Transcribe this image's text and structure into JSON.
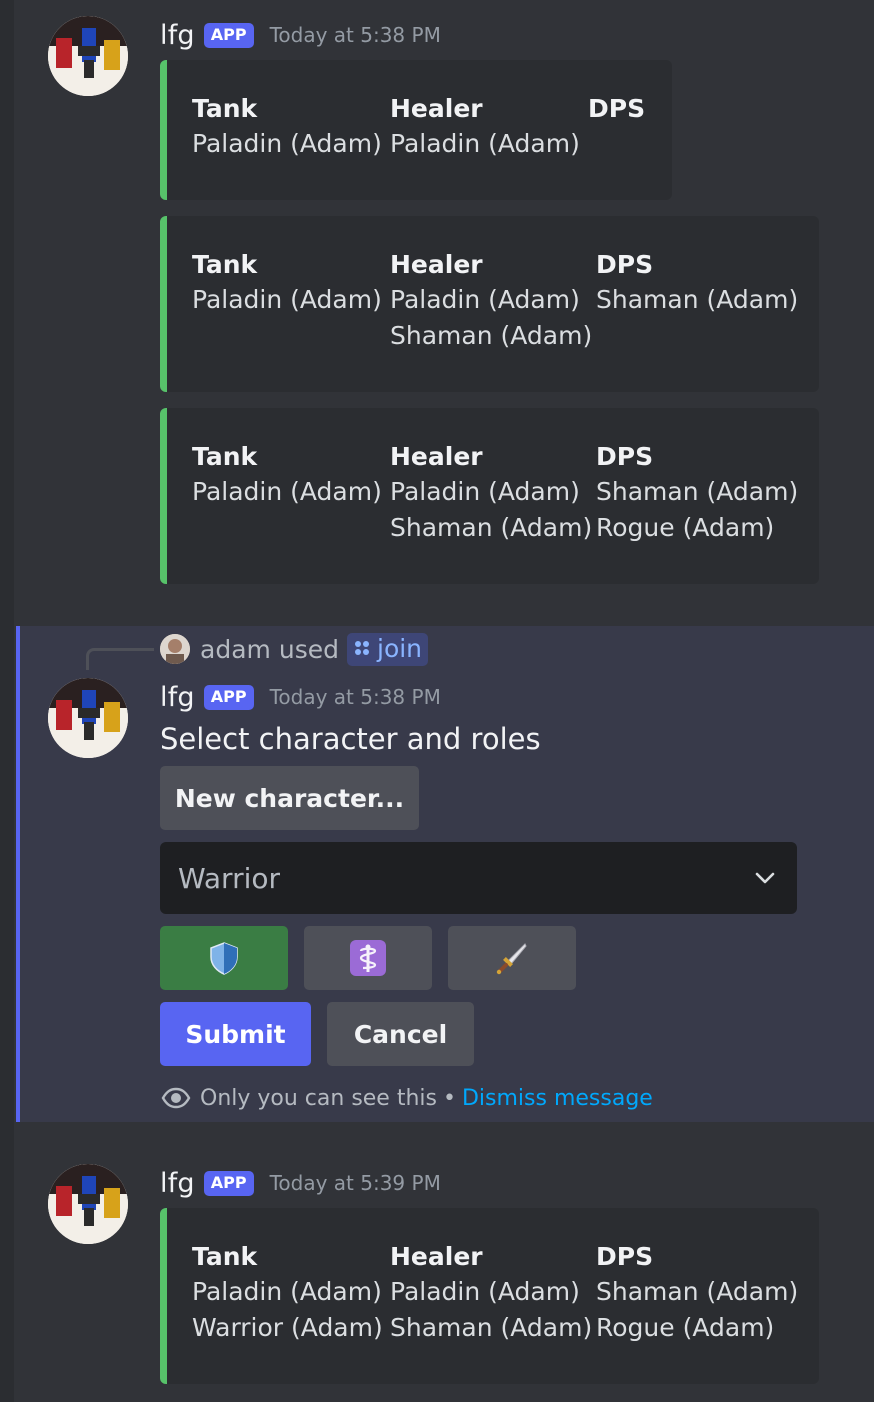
{
  "messages": [
    {
      "username": "lfg",
      "badge": "APP",
      "timestamp": "Today at 5:38 PM",
      "embeds": [
        {
          "columns": [
            {
              "name": "Tank",
              "values": [
                "Paladin (Adam)"
              ]
            },
            {
              "name": "Healer",
              "values": [
                "Paladin (Adam)"
              ]
            },
            {
              "name": "DPS",
              "values": []
            }
          ]
        },
        {
          "columns": [
            {
              "name": "Tank",
              "values": [
                "Paladin (Adam)"
              ]
            },
            {
              "name": "Healer",
              "values": [
                "Paladin (Adam)",
                "Shaman (Adam)"
              ]
            },
            {
              "name": "DPS",
              "values": [
                "Shaman (Adam)"
              ]
            }
          ]
        },
        {
          "columns": [
            {
              "name": "Tank",
              "values": [
                "Paladin (Adam)"
              ]
            },
            {
              "name": "Healer",
              "values": [
                "Paladin (Adam)",
                "Shaman (Adam)"
              ]
            },
            {
              "name": "DPS",
              "values": [
                "Shaman (Adam)",
                "Rogue (Adam)"
              ]
            }
          ]
        }
      ]
    },
    {
      "reply": {
        "user": "adam",
        "used_label": "used",
        "command": "join"
      },
      "username": "lfg",
      "badge": "APP",
      "timestamp": "Today at 5:38 PM",
      "text": "Select character and roles",
      "new_character_label": "New character...",
      "select_value": "Warrior",
      "role_buttons": [
        {
          "icon": "shield-icon",
          "selected": true,
          "color": "#3a7d44"
        },
        {
          "icon": "medical-staff-icon",
          "selected": false,
          "color": "#4e5058"
        },
        {
          "icon": "dagger-icon",
          "selected": false,
          "color": "#4e5058"
        }
      ],
      "submit_label": "Submit",
      "cancel_label": "Cancel",
      "footer": {
        "only_you": "Only you can see this",
        "separator": "•",
        "dismiss": "Dismiss message"
      }
    },
    {
      "username": "lfg",
      "badge": "APP",
      "timestamp": "Today at 5:39 PM",
      "embeds": [
        {
          "columns": [
            {
              "name": "Tank",
              "values": [
                "Paladin (Adam)",
                "Warrior (Adam)"
              ]
            },
            {
              "name": "Healer",
              "values": [
                "Paladin (Adam)",
                "Shaman (Adam)"
              ]
            },
            {
              "name": "DPS",
              "values": [
                "Shaman (Adam)",
                "Rogue (Adam)"
              ]
            }
          ]
        }
      ]
    }
  ],
  "colors": {
    "accent": "#5865f2",
    "embed_bar": "#57c26a",
    "link": "#00a8fc",
    "success": "#3a7d44"
  }
}
